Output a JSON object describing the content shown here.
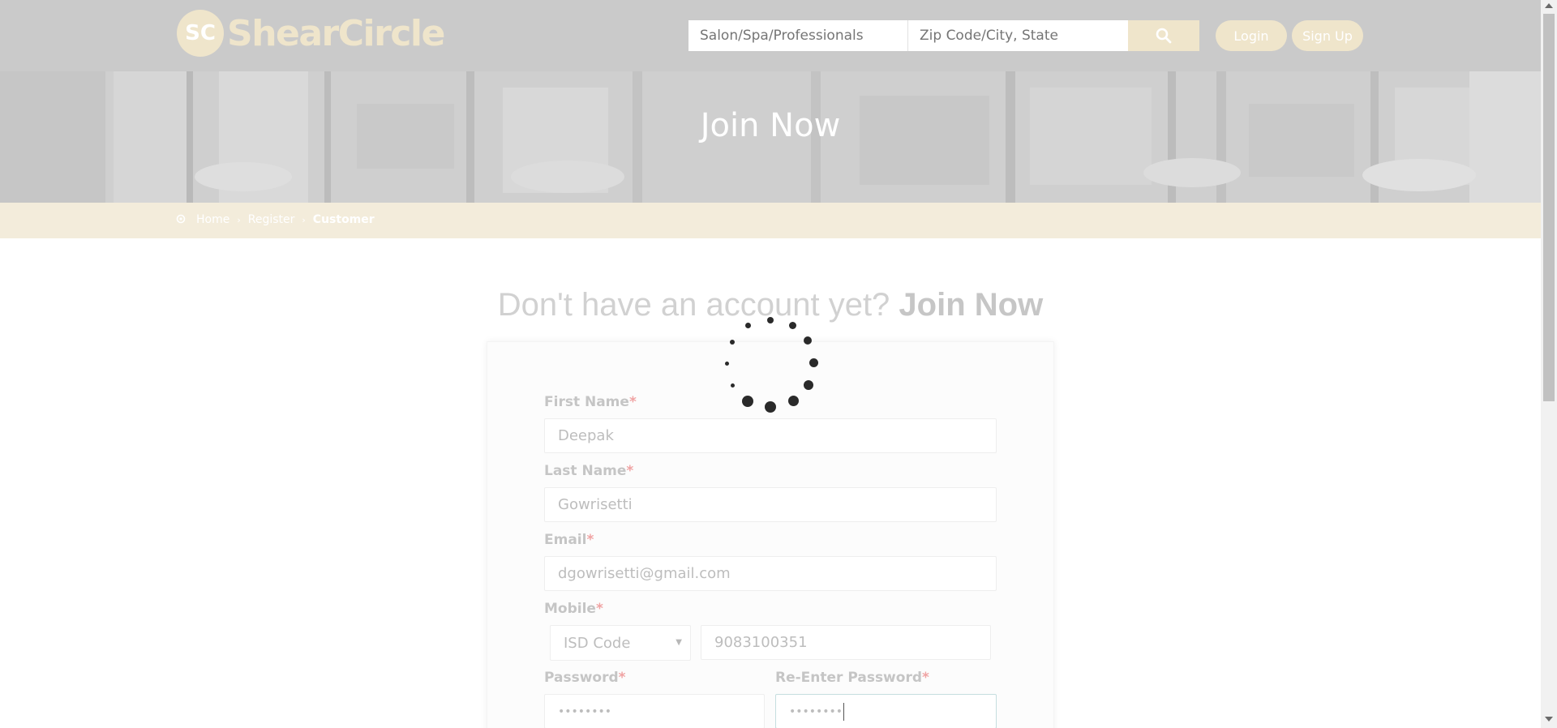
{
  "header": {
    "logo_mark": "SC",
    "logo_text": "ShearCircle",
    "search_service_placeholder": "Salon/Spa/Professionals",
    "search_location_placeholder": "Zip Code/City, State",
    "login_label": "Login",
    "signup_label": "Sign Up"
  },
  "hero": {
    "title": "Join Now"
  },
  "breadcrumb": {
    "home": "Home",
    "register": "Register",
    "current": "Customer"
  },
  "headline": {
    "text": "Don't have an account yet?",
    "emphasis": "Join Now"
  },
  "form": {
    "first_name": {
      "label": "First Name",
      "required": "*",
      "value": "Deepak"
    },
    "last_name": {
      "label": "Last Name",
      "required": "*",
      "value": "Gowrisetti"
    },
    "email": {
      "label": "Email",
      "required": "*",
      "value": "dgowrisetti@gmail.com"
    },
    "mobile": {
      "label": "Mobile",
      "required": "*",
      "isd_value": "ISD Code",
      "number": "9083100351"
    },
    "password": {
      "label": "Password",
      "required": "*",
      "value": "••••••••"
    },
    "reenter_password": {
      "label": "Re-Enter Password",
      "required": "*",
      "value": "••••••••"
    }
  },
  "colors": {
    "accent": "#efe5cb",
    "header_overlay": "#cacaca",
    "breadcrumb_bg": "#f3ecdb",
    "required": "#f0a3a3"
  },
  "icons": {
    "search": "search-icon",
    "home": "map-pin-icon",
    "loading": "loading-spinner-icon"
  }
}
